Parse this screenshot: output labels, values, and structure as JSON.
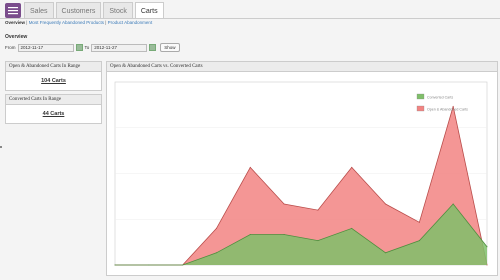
{
  "tabs": [
    "Sales",
    "Customers",
    "Stock",
    "Carts"
  ],
  "active_tab": "Carts",
  "subnav": {
    "current": "Overview",
    "links": [
      "Most Frequently Abandoned Products",
      "Product Abandonment"
    ]
  },
  "overview_title": "Overview",
  "range": {
    "from_label": "From",
    "from_value": "2012-11-17",
    "to_label": "To",
    "to_value": "2012-11-27",
    "show_label": "Show"
  },
  "stats": [
    {
      "title": "Open & Abandoned Carts In Range",
      "value": "104 Carts"
    },
    {
      "title": "Converted Carts In Range",
      "value": "44 Carts"
    }
  ],
  "chart_title": "Open & Abandoned Carts vs. Converted Carts",
  "chart_data": {
    "type": "area",
    "title": "Open & Abandoned Carts vs. Converted Carts",
    "xlabel": "",
    "ylabel": "",
    "ylim": [
      0,
      30
    ],
    "legend": "top-right",
    "grid": true,
    "series": [
      {
        "name": "Converted Carts",
        "color": "#7fbf6a",
        "values": [
          0,
          0,
          0,
          2,
          5,
          5,
          4,
          6,
          2,
          4,
          10,
          3
        ]
      },
      {
        "name": "Open & Abandoned Carts",
        "color": "#f28482",
        "values": [
          0,
          0,
          0,
          6,
          16,
          10,
          9,
          16,
          10,
          7,
          26,
          0
        ]
      }
    ]
  },
  "colors": {
    "converted": "#7fbf6a",
    "abandoned": "#f28482",
    "accent": "#7a4d8c"
  }
}
